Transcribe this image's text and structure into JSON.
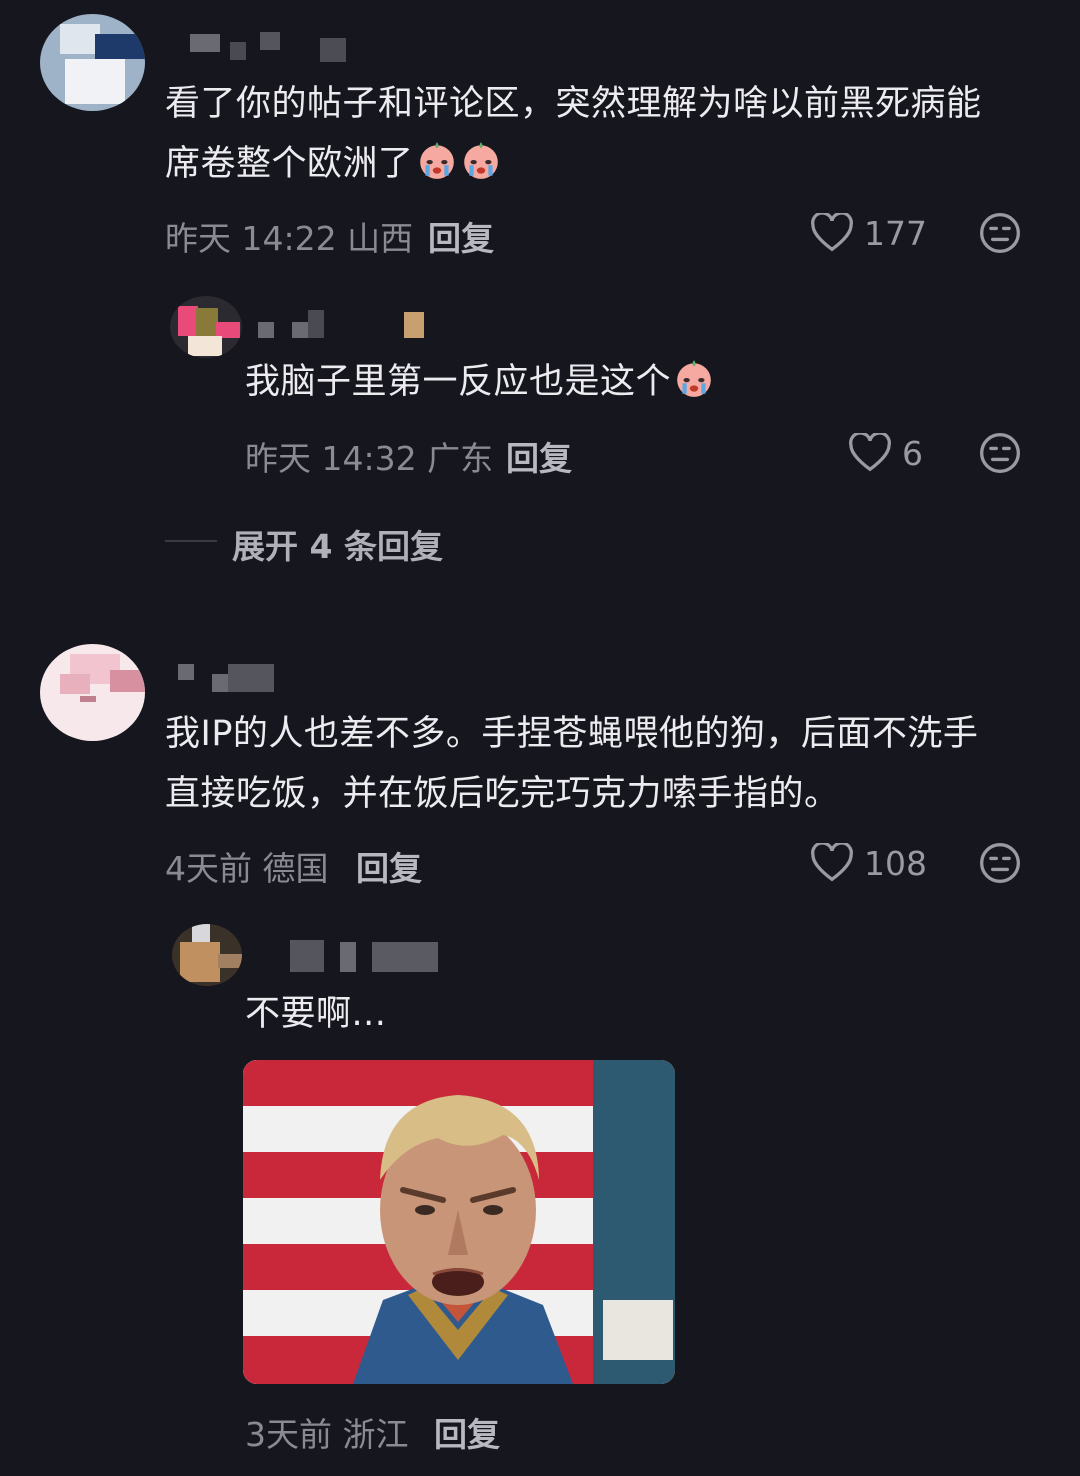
{
  "comments": [
    {
      "text_line1": "看了你的帖子和评论区，突然理解为啥以前黑死病能",
      "text_line2": "席卷整个欧洲了",
      "meta": "昨天 14:22 山西",
      "reply_label": "回复",
      "likes": "177",
      "emoji_name": "crying-face"
    },
    {
      "text_line1": "我IP的人也差不多。手捏苍蝇喂他的狗，后面不洗手",
      "text_line2": "直接吃饭，并在饭后吃完巧克力嗦手指的。",
      "meta": "4天前 德国",
      "reply_label": "回复",
      "likes": "108"
    }
  ],
  "replies": [
    {
      "text": "我脑子里第一反应也是这个",
      "meta": "昨天 14:32 广东",
      "reply_label": "回复",
      "likes": "6"
    },
    {
      "text": "不要啊...",
      "meta": "3天前 浙江",
      "reply_label": "回复",
      "image": "meme-image"
    }
  ],
  "expand_label": "展开 4 条回复",
  "colors": {
    "background": "#16161e",
    "meta": "#8a8a93",
    "text": "#ececf0"
  }
}
